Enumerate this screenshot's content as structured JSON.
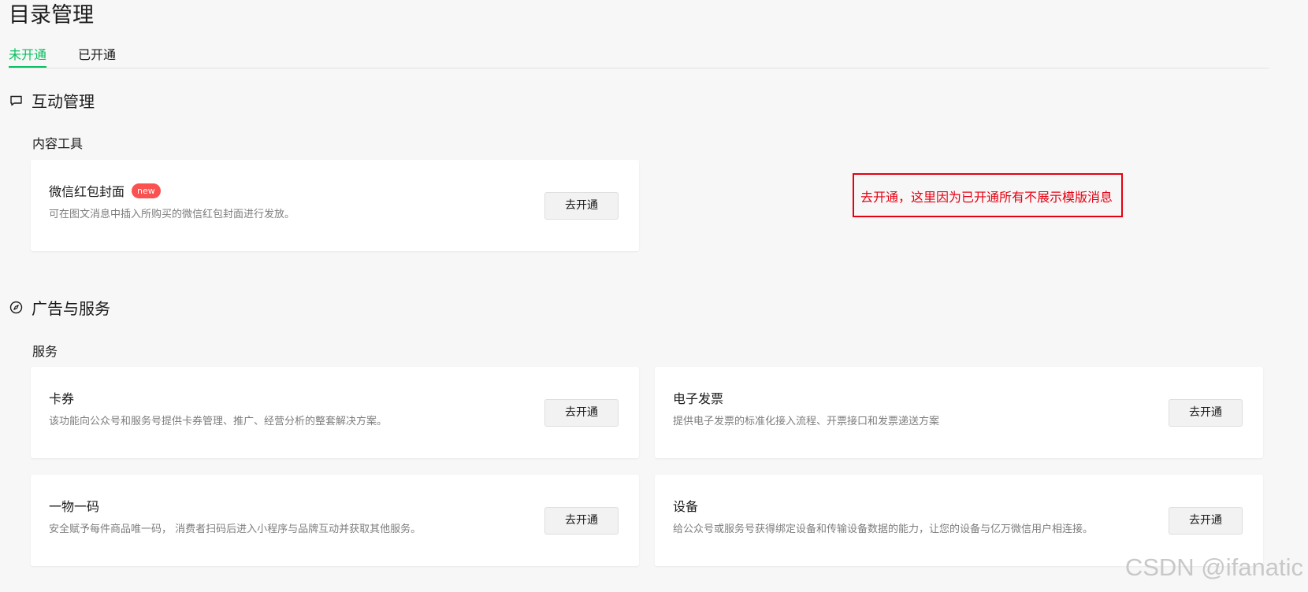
{
  "page": {
    "title": "目录管理"
  },
  "tabs": [
    {
      "label": "未开通",
      "active": true
    },
    {
      "label": "已开通",
      "active": false
    }
  ],
  "sections": [
    {
      "title": "互动管理",
      "icon": "chat-bubble-icon",
      "groups": [
        {
          "label": "内容工具",
          "cards": [
            {
              "title": "微信红包封面",
              "badge": "new",
              "desc": "可在图文消息中插入所购买的微信红包封面进行发放。",
              "button": "去开通"
            }
          ]
        }
      ]
    },
    {
      "title": "广告与服务",
      "icon": "compass-icon",
      "groups": [
        {
          "label": "服务",
          "cards": [
            {
              "title": "卡券",
              "desc": "该功能向公众号和服务号提供卡券管理、推广、经营分析的整套解决方案。",
              "button": "去开通"
            },
            {
              "title": "电子发票",
              "desc": "提供电子发票的标准化接入流程、开票接口和发票递送方案",
              "button": "去开通"
            },
            {
              "title": "一物一码",
              "desc": "安全赋予每件商品唯一码， 消费者扫码后进入小程序与品牌互动并获取其他服务。",
              "button": "去开通"
            },
            {
              "title": "设备",
              "desc": "给公众号或服务号获得绑定设备和传输设备数据的能力，让您的设备与亿万微信用户相连接。",
              "button": "去开通"
            }
          ]
        }
      ]
    }
  ],
  "annotation": {
    "text": "去开通，这里因为已开通所有不展示模版消息"
  },
  "watermark": {
    "text": "CSDN @ifanatic"
  },
  "colors": {
    "accent": "#07c160",
    "badge": "#fa5151",
    "annotation": "#e60012",
    "background": "#f7f7f7"
  }
}
